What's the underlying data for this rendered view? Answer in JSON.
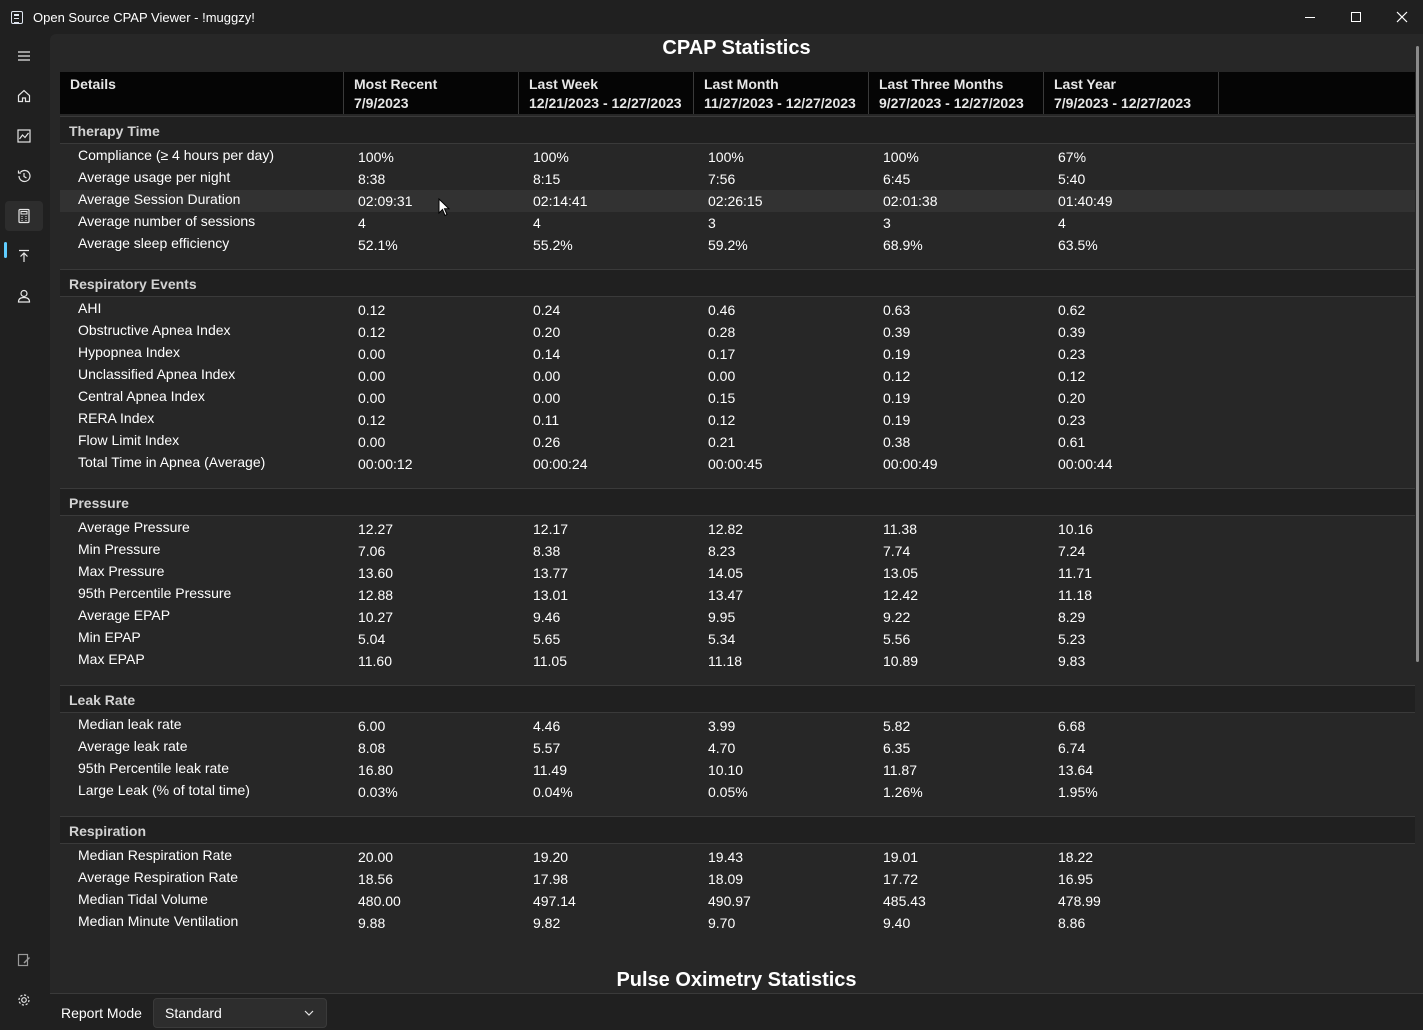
{
  "window": {
    "title": "Open Source CPAP Viewer - !muggzy!",
    "controls": [
      "minimize-icon",
      "maximize-icon",
      "close-icon"
    ]
  },
  "rail": {
    "items": [
      {
        "icon": "hamburger-menu-icon"
      },
      {
        "icon": "home-icon"
      },
      {
        "icon": "chart-icon"
      },
      {
        "icon": "history-icon"
      },
      {
        "icon": "calculator-icon",
        "active": true
      },
      {
        "icon": "upload-icon"
      },
      {
        "icon": "profile-icon"
      },
      {
        "icon": "notes-icon"
      },
      {
        "icon": "settings-icon"
      }
    ]
  },
  "page_title": "CPAP Statistics",
  "columns": [
    {
      "title": "Details",
      "range": ""
    },
    {
      "title": "Most Recent",
      "range": "7/9/2023"
    },
    {
      "title": "Last Week",
      "range": "12/21/2023 - 12/27/2023"
    },
    {
      "title": "Last Month",
      "range": "11/27/2023 - 12/27/2023"
    },
    {
      "title": "Last Three Months",
      "range": "9/27/2023 - 12/27/2023"
    },
    {
      "title": "Last Year",
      "range": "7/9/2023 - 12/27/2023"
    }
  ],
  "sections": [
    {
      "title": "Therapy Time",
      "rows": [
        {
          "label": "Compliance (≥ 4 hours per day)",
          "values": [
            "100%",
            "100%",
            "100%",
            "100%",
            "67%"
          ]
        },
        {
          "label": "Average usage per night",
          "values": [
            "8:38",
            "8:15",
            "7:56",
            "6:45",
            "5:40"
          ]
        },
        {
          "label": "Average Session Duration",
          "values": [
            "02:09:31",
            "02:14:41",
            "02:26:15",
            "02:01:38",
            "01:40:49"
          ]
        },
        {
          "label": "Average number of sessions",
          "values": [
            "4",
            "4",
            "3",
            "3",
            "4"
          ]
        },
        {
          "label": "Average sleep efficiency",
          "values": [
            "52.1%",
            "55.2%",
            "59.2%",
            "68.9%",
            "63.5%"
          ]
        }
      ]
    },
    {
      "title": "Respiratory Events",
      "rows": [
        {
          "label": "AHI",
          "values": [
            "0.12",
            "0.24",
            "0.46",
            "0.63",
            "0.62"
          ]
        },
        {
          "label": "Obstructive Apnea Index",
          "values": [
            "0.12",
            "0.20",
            "0.28",
            "0.39",
            "0.39"
          ]
        },
        {
          "label": "Hypopnea Index",
          "values": [
            "0.00",
            "0.14",
            "0.17",
            "0.19",
            "0.23"
          ]
        },
        {
          "label": "Unclassified Apnea Index",
          "values": [
            "0.00",
            "0.00",
            "0.00",
            "0.12",
            "0.12"
          ]
        },
        {
          "label": "Central Apnea Index",
          "values": [
            "0.00",
            "0.00",
            "0.15",
            "0.19",
            "0.20"
          ]
        },
        {
          "label": "RERA Index",
          "values": [
            "0.12",
            "0.11",
            "0.12",
            "0.19",
            "0.23"
          ]
        },
        {
          "label": "Flow Limit Index",
          "values": [
            "0.00",
            "0.26",
            "0.21",
            "0.38",
            "0.61"
          ]
        },
        {
          "label": "Total Time in Apnea (Average)",
          "values": [
            "00:00:12",
            "00:00:24",
            "00:00:45",
            "00:00:49",
            "00:00:44"
          ]
        }
      ]
    },
    {
      "title": "Pressure",
      "rows": [
        {
          "label": "Average Pressure",
          "values": [
            "12.27",
            "12.17",
            "12.82",
            "11.38",
            "10.16"
          ]
        },
        {
          "label": "Min Pressure",
          "values": [
            "7.06",
            "8.38",
            "8.23",
            "7.74",
            "7.24"
          ]
        },
        {
          "label": "Max Pressure",
          "values": [
            "13.60",
            "13.77",
            "14.05",
            "13.05",
            "11.71"
          ]
        },
        {
          "label": "95th Percentile Pressure",
          "values": [
            "12.88",
            "13.01",
            "13.47",
            "12.42",
            "11.18"
          ]
        },
        {
          "label": "Average EPAP",
          "values": [
            "10.27",
            "9.46",
            "9.95",
            "9.22",
            "8.29"
          ]
        },
        {
          "label": "Min EPAP",
          "values": [
            "5.04",
            "5.65",
            "5.34",
            "5.56",
            "5.23"
          ]
        },
        {
          "label": "Max EPAP",
          "values": [
            "11.60",
            "11.05",
            "11.18",
            "10.89",
            "9.83"
          ]
        }
      ]
    },
    {
      "title": "Leak Rate",
      "rows": [
        {
          "label": "Median leak rate",
          "values": [
            "6.00",
            "4.46",
            "3.99",
            "5.82",
            "6.68"
          ]
        },
        {
          "label": "Average leak rate",
          "values": [
            "8.08",
            "5.57",
            "4.70",
            "6.35",
            "6.74"
          ]
        },
        {
          "label": "95th Percentile leak rate",
          "values": [
            "16.80",
            "11.49",
            "10.10",
            "11.87",
            "13.64"
          ]
        },
        {
          "label": "Large Leak (% of total time)",
          "values": [
            "0.03%",
            "0.04%",
            "0.05%",
            "1.26%",
            "1.95%"
          ]
        }
      ]
    },
    {
      "title": "Respiration",
      "rows": [
        {
          "label": "Median Respiration Rate",
          "values": [
            "20.00",
            "19.20",
            "19.43",
            "19.01",
            "18.22"
          ]
        },
        {
          "label": "Average Respiration Rate",
          "values": [
            "18.56",
            "17.98",
            "18.09",
            "17.72",
            "16.95"
          ]
        },
        {
          "label": "Median Tidal Volume",
          "values": [
            "480.00",
            "497.14",
            "490.97",
            "485.43",
            "478.99"
          ]
        },
        {
          "label": "Median Minute Ventilation",
          "values": [
            "9.88",
            "9.82",
            "9.70",
            "9.40",
            "8.86"
          ]
        }
      ]
    }
  ],
  "next_section_title": "Pulse Oximetry Statistics",
  "footer": {
    "report_mode_label": "Report Mode",
    "report_mode_value": "Standard"
  },
  "colors": {
    "background": "#202020",
    "content": "#272727",
    "header": "#050505",
    "accent": "#60cdff"
  }
}
